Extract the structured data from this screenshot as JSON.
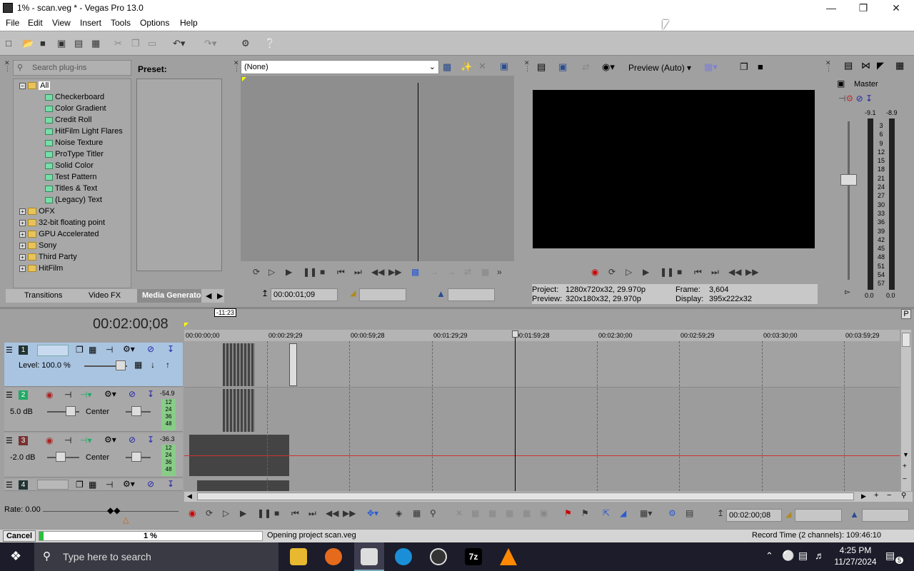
{
  "window": {
    "title": "1% - scan.veg * - Vegas Pro 13.0",
    "min": "—",
    "max": "❐",
    "close": "✕"
  },
  "menu": [
    "File",
    "Edit",
    "View",
    "Insert",
    "Tools",
    "Options",
    "Help"
  ],
  "plugins": {
    "search_placeholder": "Search plug-ins",
    "preset_label": "Preset:",
    "root": "All",
    "generators": [
      "Checkerboard",
      "Color Gradient",
      "Credit Roll",
      "HitFilm Light Flares",
      "Noise Texture",
      "ProType Titler",
      "Solid Color",
      "Test Pattern",
      "Titles & Text",
      "(Legacy) Text"
    ],
    "folders": [
      "OFX",
      "32-bit floating point",
      "GPU Accelerated",
      "Sony",
      "Third Party",
      "HitFilm"
    ],
    "tabs": [
      "Transitions",
      "Video FX",
      "Media Generators"
    ]
  },
  "trimmer": {
    "dropdown": "(None)",
    "timecode": "00:00:01;09"
  },
  "preview": {
    "mode": "Preview (Auto)",
    "project_label": "Project:",
    "project": "1280x720x32, 29.970p",
    "preview_label": "Preview:",
    "preview": "320x180x32, 29.970p",
    "frame_label": "Frame:",
    "frame": "3,604",
    "display_label": "Display:",
    "display": "395x222x32"
  },
  "master": {
    "label": "Master",
    "left": "-9.1",
    "right": "-8.9",
    "scale": [
      "3",
      "6",
      "9",
      "12",
      "15",
      "18",
      "21",
      "24",
      "27",
      "30",
      "33",
      "36",
      "39",
      "42",
      "45",
      "48",
      "51",
      "54",
      "57"
    ],
    "bottom_left": "0.0",
    "bottom_right": "0.0"
  },
  "timeline": {
    "timecode": "00:02:00;08",
    "cursor_label": "-11:23",
    "ruler": [
      "00:00:00;00",
      "00:00:29;29",
      "00:00:59;28",
      "00:01:29;29",
      "00:01:59;28",
      "00:02:30;00",
      "00:02:59;29",
      "00:03:30;00",
      "00:03:59;29"
    ],
    "tracks": [
      {
        "num": "1",
        "level": "Level: 100.0 %"
      },
      {
        "num": "2",
        "vol": "5.0 dB",
        "pan": "Center",
        "peak": "-54.9"
      },
      {
        "num": "3",
        "vol": "-2.0 dB",
        "pan": "Center",
        "peak": "-36.3"
      },
      {
        "num": "4"
      }
    ],
    "meter_marks": [
      "12",
      "24",
      "36",
      "48"
    ],
    "rate": "Rate: 0.00",
    "end_timecode": "00:02:00;08"
  },
  "status": {
    "cancel": "Cancel",
    "progress_text": "1 %",
    "progress": 0.01,
    "message": "Opening project scan.veg",
    "record_time": "Record Time (2 channels): 109:46:10"
  },
  "taskbar": {
    "search": "Type here to search",
    "time": "4:25 PM",
    "date": "11/27/2024",
    "notif": "5"
  }
}
